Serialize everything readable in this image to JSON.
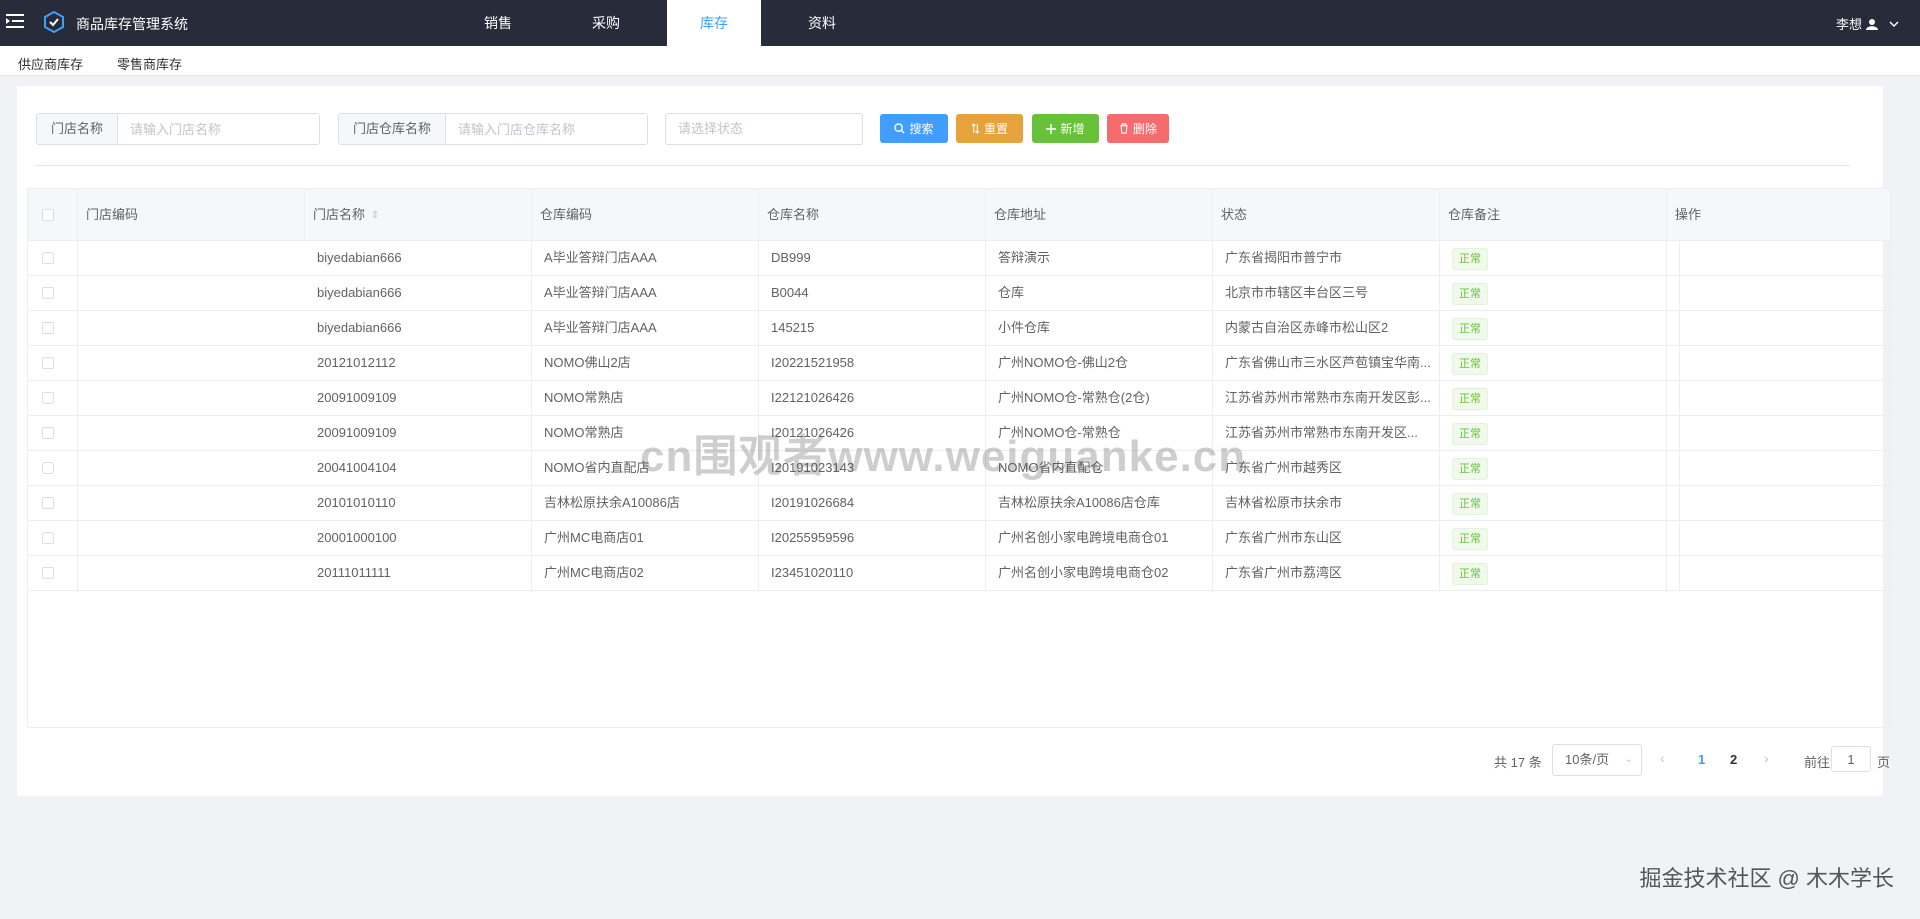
{
  "header": {
    "app_title": "商品库存管理系统",
    "tabs": [
      {
        "label": "销售",
        "active": false
      },
      {
        "label": "采购",
        "active": false
      },
      {
        "label": "库存",
        "active": true
      },
      {
        "label": "资料",
        "active": false
      }
    ],
    "user": "李想"
  },
  "subnav": {
    "items": [
      "供应商库存",
      "零售商库存"
    ]
  },
  "filters": {
    "store_name_label": "门店名称",
    "store_name_placeholder": "请输入门店名称",
    "warehouse_name_label": "门店仓库名称",
    "warehouse_name_placeholder": "请输入门店仓库名称",
    "status_placeholder": "请选择状态",
    "search_label": "搜索",
    "reset_label": "重置",
    "add_label": "新增",
    "delete_label": "删除"
  },
  "table": {
    "columns": [
      "门店编码",
      "门店名称",
      "仓库编码",
      "仓库名称",
      "仓库地址",
      "状态",
      "仓库备注",
      "操作"
    ],
    "rows": [
      {
        "store_code": "biyedabian666",
        "store_name": "A毕业答辩门店AAA",
        "wh_code": "DB999",
        "wh_name": "答辩演示",
        "address": "广东省揭阳市普宁市",
        "status": "正常",
        "remark": ""
      },
      {
        "store_code": "biyedabian666",
        "store_name": "A毕业答辩门店AAA",
        "wh_code": "B0044",
        "wh_name": "仓库",
        "address": "北京市市辖区丰台区三号",
        "status": "正常",
        "remark": ""
      },
      {
        "store_code": "biyedabian666",
        "store_name": "A毕业答辩门店AAA",
        "wh_code": "145215",
        "wh_name": "小件仓库",
        "address": "内蒙古自治区赤峰市松山区2",
        "status": "正常",
        "remark": ""
      },
      {
        "store_code": "20121012112",
        "store_name": "NOMO佛山2店",
        "wh_code": "I20221521958",
        "wh_name": "广州NOMO仓-佛山2仓",
        "address": "广东省佛山市三水区芦苞镇宝华南...",
        "status": "正常",
        "remark": ""
      },
      {
        "store_code": "20091009109",
        "store_name": "NOMO常熟店",
        "wh_code": "I22121026426",
        "wh_name": "广州NOMO仓-常熟仓(2仓)",
        "address": "江苏省苏州市常熟市东南开发区彭...",
        "status": "正常",
        "remark": ""
      },
      {
        "store_code": "20091009109",
        "store_name": "NOMO常熟店",
        "wh_code": "I20121026426",
        "wh_name": "广州NOMO仓-常熟仓",
        "address": "江苏省苏州市常熟市东南开发区...",
        "status": "正常",
        "remark": ""
      },
      {
        "store_code": "20041004104",
        "store_name": "NOMO省内直配店",
        "wh_code": "I20191023143",
        "wh_name": "NOMO省内直配仓",
        "address": "广东省广州市越秀区",
        "status": "正常",
        "remark": ""
      },
      {
        "store_code": "20101010110",
        "store_name": "吉林松原扶余A10086店",
        "wh_code": "I20191026684",
        "wh_name": "吉林松原扶余A10086店仓库",
        "address": "吉林省松原市扶余市",
        "status": "正常",
        "remark": ""
      },
      {
        "store_code": "20001000100",
        "store_name": "广州MC电商店01",
        "wh_code": "I20255959596",
        "wh_name": "广州名创小家电跨境电商仓01",
        "address": "广东省广州市东山区",
        "status": "正常",
        "remark": ""
      },
      {
        "store_code": "20111011111",
        "store_name": "广州MC电商店02",
        "wh_code": "I23451020110",
        "wh_name": "广州名创小家电跨境电商仓02",
        "address": "广东省广州市荔湾区",
        "status": "正常",
        "remark": ""
      }
    ]
  },
  "pagination": {
    "total_text": "共 17 条",
    "page_size": "10条/页",
    "pages": [
      "1",
      "2"
    ],
    "current_page": "1",
    "goto_label": "前往",
    "goto_value": "1",
    "goto_suffix": "页"
  },
  "watermark": "cn围观者www.weiguanke.cn",
  "credit": "掘金技术社区 @ 木木学长",
  "colors": {
    "navbar_bg": "#282c3a",
    "primary": "#409eff",
    "warning": "#e6a23c",
    "success": "#67c23a",
    "danger": "#f56c6c"
  }
}
